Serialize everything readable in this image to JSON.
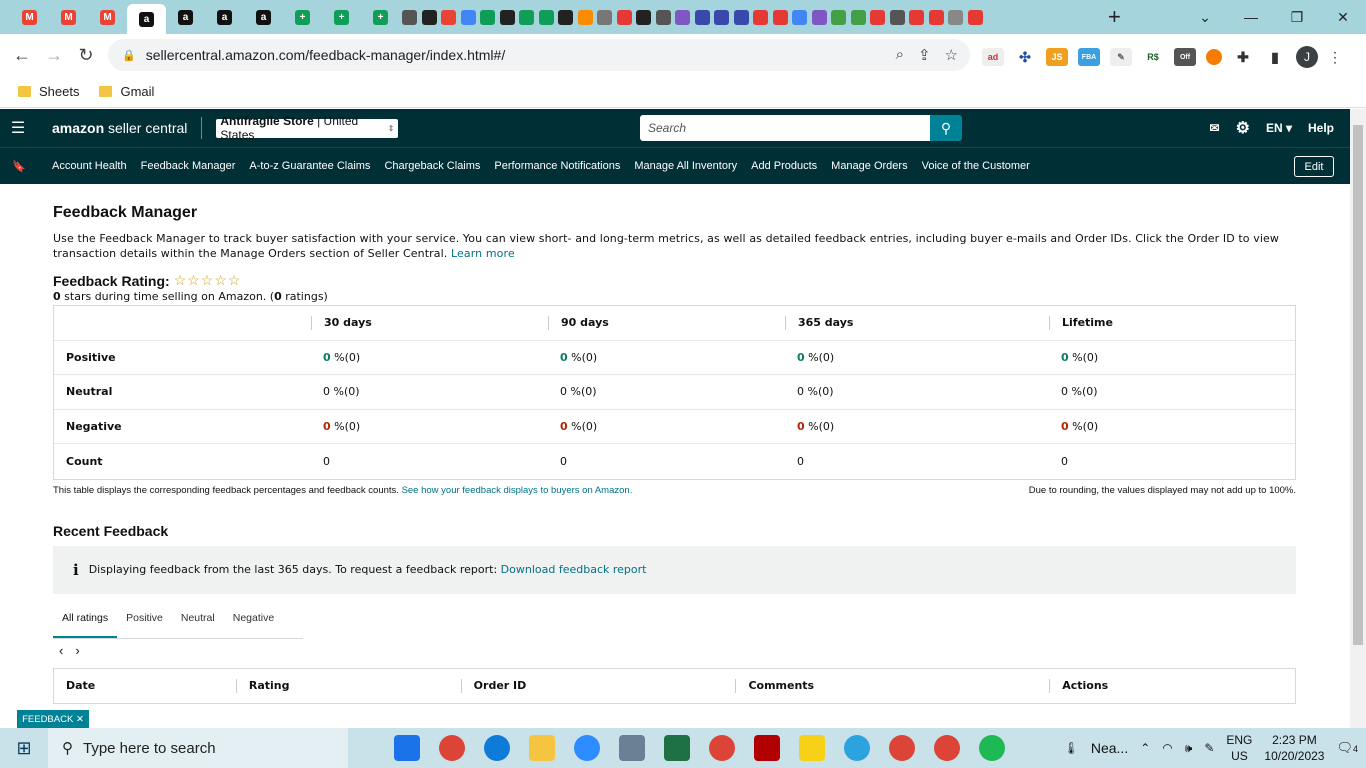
{
  "browser": {
    "tabs": [
      {
        "icon": "gmail-icon",
        "color": "#ea4335",
        "glyph": "M"
      },
      {
        "icon": "gmail-icon",
        "color": "#ea4335",
        "glyph": "M"
      },
      {
        "icon": "gmail-icon",
        "color": "#ea4335",
        "glyph": "M"
      },
      {
        "icon": "amazon-icon",
        "color": "#111111",
        "glyph": "a",
        "active": true
      },
      {
        "icon": "amazon-icon",
        "color": "#111111",
        "glyph": "a"
      },
      {
        "icon": "amazon-icon",
        "color": "#111111",
        "glyph": "a"
      },
      {
        "icon": "amazon-icon",
        "color": "#111111",
        "glyph": "a"
      },
      {
        "icon": "sheets-icon",
        "color": "#0f9d58",
        "glyph": "+"
      },
      {
        "icon": "sheets-icon",
        "color": "#0f9d58",
        "glyph": "+"
      },
      {
        "icon": "sheets-icon",
        "color": "#0f9d58",
        "glyph": "+"
      }
    ],
    "url": "sellercentral.amazon.com/feedback-manager/index.html#/",
    "bookmarks": [
      "Sheets",
      "Gmail"
    ],
    "profile_initial": "J"
  },
  "header": {
    "logo_main": "amazon",
    "logo_sub": "seller central",
    "store_name": "Antifragile Store",
    "store_region": "United States",
    "search_placeholder": "Search",
    "lang": "EN",
    "help": "Help"
  },
  "nav": {
    "links": [
      "Account Health",
      "Feedback Manager",
      "A-to-z Guarantee Claims",
      "Chargeback Claims",
      "Performance Notifications",
      "Manage All Inventory",
      "Add Products",
      "Manage Orders",
      "Voice of the Customer"
    ],
    "edit": "Edit"
  },
  "page": {
    "title": "Feedback Manager",
    "description": "Use the Feedback Manager to track buyer satisfaction with your service. You can view short- and long-term metrics, as well as detailed feedback entries, including buyer e-mails and Order IDs. Click the Order ID to view transaction details within the Manage Orders section of Seller Central.",
    "learn_more": "Learn more",
    "rating_label": "Feedback Rating:",
    "stars_count": "0",
    "stars_text": " stars during time selling on Amazon. (",
    "ratings_count": "0",
    "ratings_suffix": " ratings)",
    "table": {
      "headers": [
        "",
        "30 days",
        "90 days",
        "365 days",
        "Lifetime"
      ],
      "rows": [
        {
          "label": "Positive",
          "tone": "green",
          "cells": [
            [
              "0",
              " %(0)"
            ],
            [
              "0",
              " %(0)"
            ],
            [
              "0",
              " %(0)"
            ],
            [
              "0",
              " %(0)"
            ]
          ]
        },
        {
          "label": "Neutral",
          "tone": "plain",
          "cells": [
            [
              "0",
              " %(0)"
            ],
            [
              "0",
              " %(0)"
            ],
            [
              "0",
              " %(0)"
            ],
            [
              "0",
              " %(0)"
            ]
          ]
        },
        {
          "label": "Negative",
          "tone": "red",
          "cells": [
            [
              "0",
              " %(0)"
            ],
            [
              "0",
              " %(0)"
            ],
            [
              "0",
              " %(0)"
            ],
            [
              "0",
              " %(0)"
            ]
          ]
        },
        {
          "label": "Count",
          "tone": "plain",
          "cells": [
            [
              "0",
              ""
            ],
            [
              "0",
              ""
            ],
            [
              "0",
              ""
            ],
            [
              "0",
              ""
            ]
          ]
        }
      ]
    },
    "note_left": "This table displays the corresponding feedback percentages and feedback counts.",
    "note_link": "See how your feedback displays to buyers on Amazon.",
    "note_right": "Due to rounding, the values displayed may not add up to 100%.",
    "recent_title": "Recent Feedback",
    "info_text": "Displaying feedback from the last 365 days. To request a feedback report:",
    "info_link": "Download feedback report",
    "rating_tabs": [
      "All ratings",
      "Positive",
      "Neutral",
      "Negative"
    ],
    "recent_headers": [
      "Date",
      "Rating",
      "Order ID",
      "Comments",
      "Actions"
    ],
    "feedback_tag": "FEEDBACK ✕"
  },
  "taskbar": {
    "search_placeholder": "Type here to search",
    "weather": "Nea...",
    "lang1": "ENG",
    "lang2": "US",
    "time": "2:23 PM",
    "date": "10/20/2023",
    "notifications": "4"
  }
}
